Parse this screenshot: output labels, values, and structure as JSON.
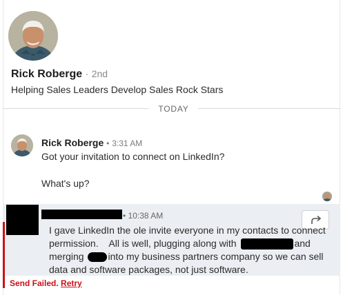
{
  "profile": {
    "name": "Rick Roberge",
    "separator": "·",
    "degree": "2nd",
    "headline": "Helping Sales Leaders Develop Sales Rock Stars"
  },
  "date_divider": "TODAY",
  "messages": [
    {
      "sender": "Rick Roberge",
      "dot": "•",
      "time": "3:31 AM",
      "lines": [
        "Got your invitation to connect on LinkedIn?",
        "What's up?"
      ]
    }
  ],
  "failed_message": {
    "dot": "•",
    "time": "10:38 AM",
    "line1": "I gave LinkedIn the ole invite everyone in my contacts to connect",
    "line2_before": "permission.    All is well, plugging along with",
    "line2_after": "and",
    "line3_before": "merging",
    "line3_after": "into my business partners company so we can sell",
    "line4": "data and software packages, not just software.",
    "status": "Send Failed.",
    "retry": "Retry"
  },
  "icons": {
    "forward": "forward-arrow-icon"
  },
  "colors": {
    "error": "#cc1016",
    "failed_bg": "#ebeef2"
  }
}
